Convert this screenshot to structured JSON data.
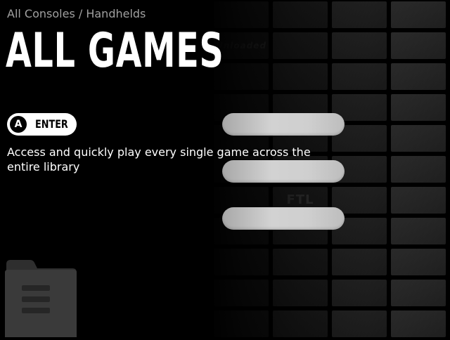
{
  "header": {
    "breadcrumb": "All Consoles / Handhelds",
    "title": "ALL GAMES"
  },
  "action": {
    "button_glyph": "A",
    "label": "ENTER"
  },
  "description": "Access and quickly play every single game across the entire library",
  "menu": {
    "items": [
      "",
      "",
      ""
    ]
  },
  "background": {
    "tile_texts": [
      "Unloaded",
      "FTL"
    ]
  },
  "icons": {
    "folder": "folder-icon"
  },
  "colors": {
    "background": "#000000",
    "text": "#ffffff",
    "breadcrumb": "#a0a0a0",
    "pill": "#ffffff",
    "menu_bar": "#cccccc"
  }
}
